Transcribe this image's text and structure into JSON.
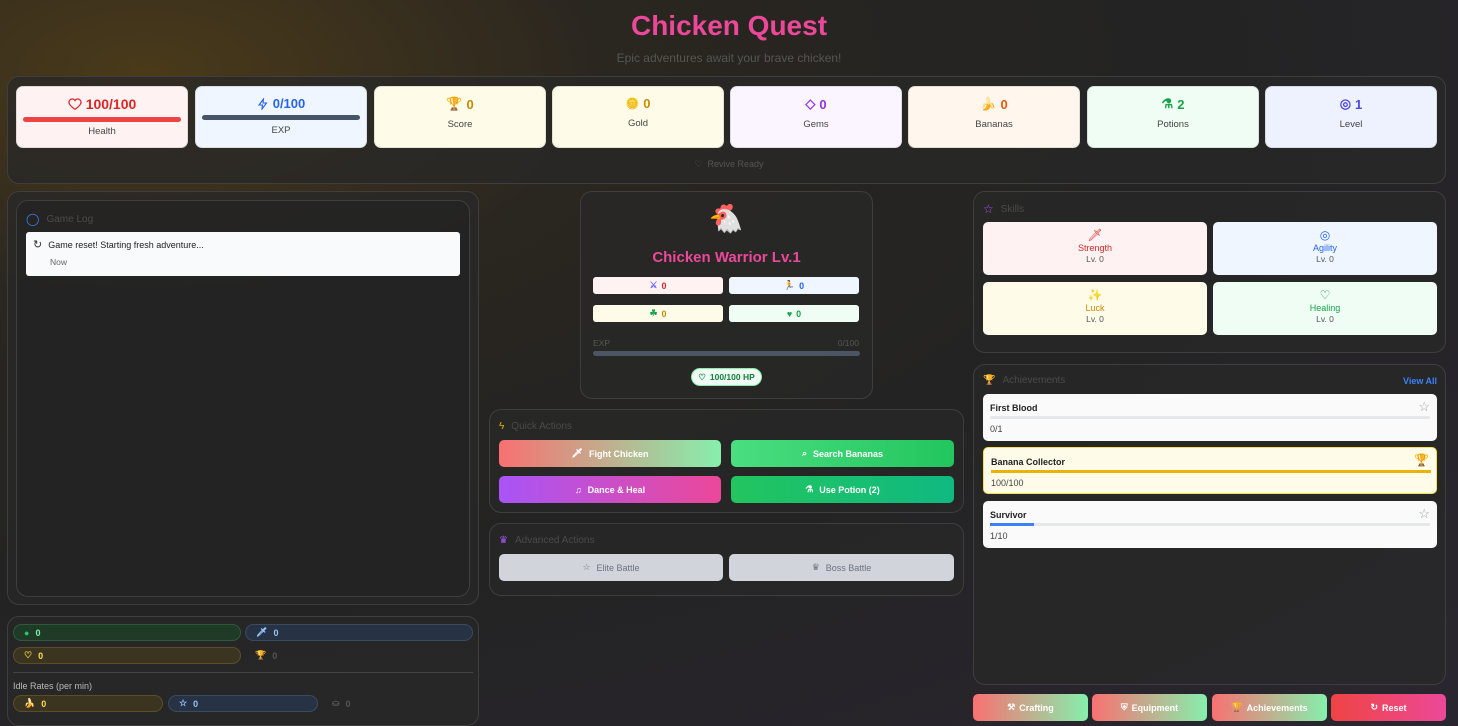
{
  "header": {
    "title": "Chicken Quest",
    "subtitle": "Epic adventures await your brave chicken!"
  },
  "stats": {
    "health": {
      "value": "100/100",
      "label": "Health",
      "fill": 1.0
    },
    "exp": {
      "value": "0/100",
      "label": "EXP",
      "fill": 0.0
    },
    "score": {
      "value": "0",
      "label": "Score"
    },
    "gold": {
      "value": "0",
      "label": "Gold"
    },
    "gems": {
      "value": "0",
      "label": "Gems"
    },
    "bananas": {
      "value": "0",
      "label": "Bananas"
    },
    "potions": {
      "value": "2",
      "label": "Potions"
    },
    "level": {
      "value": "1",
      "label": "Level"
    },
    "revive": "Revive Ready"
  },
  "game_log": {
    "title": "Game Log",
    "entries": [
      {
        "text": "Game reset! Starting fresh adventure...",
        "time": "Now"
      }
    ]
  },
  "character": {
    "name": "Chicken Warrior Lv.1",
    "avatar": "🐔",
    "attrs": [
      "0",
      "0",
      "0",
      "0"
    ],
    "exp_label": "EXP",
    "exp_value": "0/100",
    "exp_fill": 0.0,
    "hp": "100/100 HP"
  },
  "quick_actions": {
    "title": "Quick Actions",
    "fight": "Fight Chicken",
    "search": "Search Bananas",
    "dance": "Dance & Heal",
    "potion": "Use Potion (2)"
  },
  "advanced_actions": {
    "title": "Advanced Actions",
    "elite": "Elite Battle",
    "boss": "Boss Battle"
  },
  "skills": {
    "title": "Skills",
    "items": [
      {
        "name": "Strength",
        "level": "Lv. 0"
      },
      {
        "name": "Agility",
        "level": "Lv. 0"
      },
      {
        "name": "Luck",
        "level": "Lv. 0"
      },
      {
        "name": "Healing",
        "level": "Lv. 0"
      }
    ]
  },
  "achievements": {
    "title": "Achievements",
    "view_all": "View All",
    "items": [
      {
        "name": "First Blood",
        "progress": "0/1",
        "fill": 0.0
      },
      {
        "name": "Banana Collector",
        "progress": "100/100",
        "fill": 1.0
      },
      {
        "name": "Survivor",
        "progress": "1/10",
        "fill": 0.1
      }
    ]
  },
  "resources": {
    "r1": "0",
    "r2": "0",
    "r3": "0",
    "r4": "0",
    "idle_label": "Idle Rates (per min)",
    "i1": "0",
    "i2": "0",
    "i3": "0"
  },
  "bottom": {
    "crafting": "Crafting",
    "equipment": "Equipment",
    "achievements": "Achievements",
    "reset": "Reset"
  },
  "colors": {
    "accent": "#ec4899",
    "health": "#ef4444",
    "exp": "#475569"
  }
}
